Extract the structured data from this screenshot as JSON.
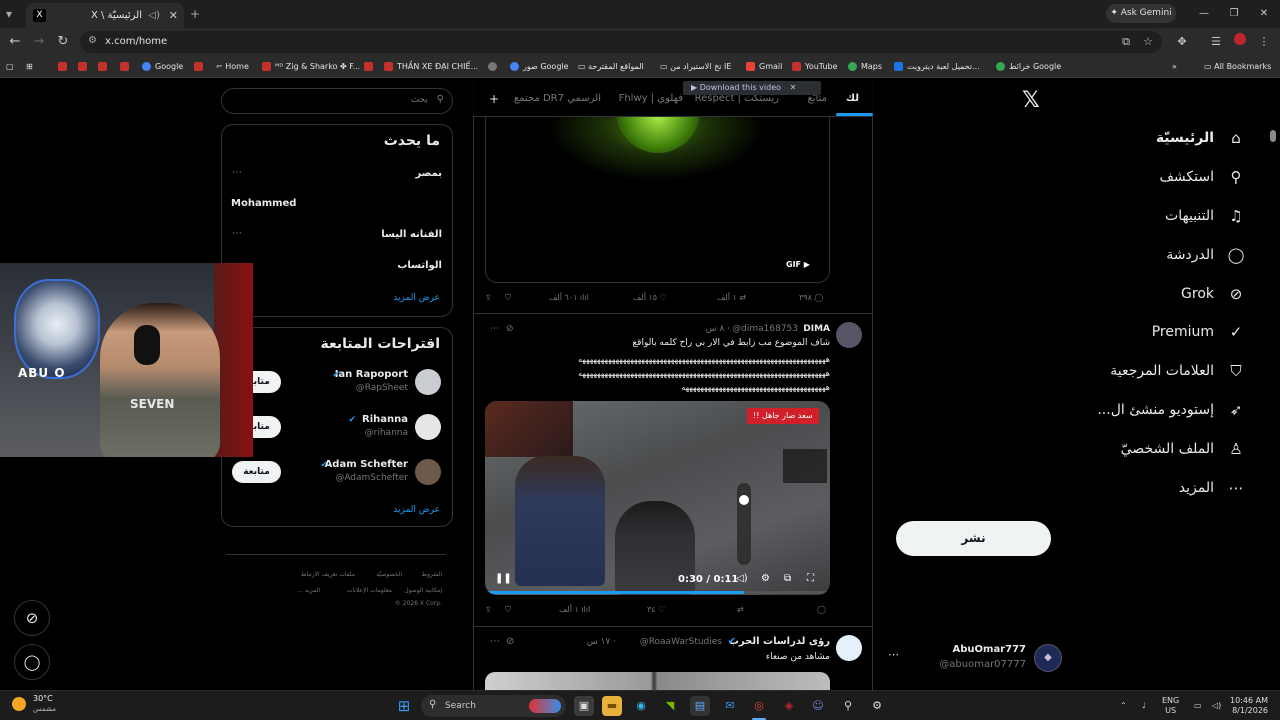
{
  "browser": {
    "tab_title": "الرئيسيّة \\ X",
    "tab_favicon": "X",
    "ask_gemini": "Ask Gemini",
    "url": "x.com/home",
    "bookmarks": [
      "Google",
      "Home",
      "ᴹᴰ Zig & Sharko ✤ F...",
      "THẦN XE ĐẠI CHIẾ...",
      "صور Google",
      "المواقع المقترحة",
      "تخ الاستيراد من IE",
      "Gmail",
      "YouTube",
      "Maps",
      "تحميل لعبة ديترويت...",
      "خرائط Google"
    ],
    "all_bookmarks": "All Bookmarks"
  },
  "nav": {
    "items": [
      {
        "label": "الرئيسيّة",
        "icon": "home-icon",
        "glyph": "⌂"
      },
      {
        "label": "استكشف",
        "icon": "search-icon",
        "glyph": "⚲"
      },
      {
        "label": "التنبيهات",
        "icon": "bell-icon",
        "glyph": "♫"
      },
      {
        "label": "الدردشة",
        "icon": "chat-icon",
        "glyph": "◯"
      },
      {
        "label": "Grok",
        "icon": "grok-icon",
        "glyph": "⊘"
      },
      {
        "label": "Premium",
        "icon": "premium-icon",
        "glyph": "✓"
      },
      {
        "label": "العلامات المرجعية",
        "icon": "bookmark-icon",
        "glyph": "⛉"
      },
      {
        "label": "إستوديو منشئ ال...",
        "icon": "rocket-icon",
        "glyph": "➶"
      },
      {
        "label": "الملف الشخصيّ",
        "icon": "profile-icon",
        "glyph": "♙"
      },
      {
        "label": "المزيد",
        "icon": "more-icon",
        "glyph": "⋯"
      }
    ],
    "post_button": "نشر",
    "account": {
      "name": "AbuOmar777",
      "handle": "@abuomar07777"
    }
  },
  "timeline": {
    "tabs": [
      "لك",
      "متابَع",
      "Respect | ريستكت",
      "Fhlwy | فهلوي",
      "مجتمع DR7 الرسمي"
    ],
    "download_video": "Download this video",
    "gif_label": "GIF",
    "post1_stats": {
      "replies": "٣٩٨",
      "reposts": "١ ألف",
      "likes": "١٥ ألف",
      "views": "٦٠١ ألف"
    },
    "post2": {
      "name": "DIMA",
      "handle": "@dima168753",
      "time": "· ٨ س",
      "lines": [
        "شاف الموضوع مب زابط في الار بي راح كلمه بالواقع",
        "هههههههههههههههههههههههههههههههههههههههههههههههههههههههههههههههههههه",
        "هههههههههههههههههههههههههههههههههههههههههههههههههههههههههههههههههههه",
        "هههههههههههههههههههههههههههههههههههههههه"
      ],
      "video_badge": "سعد صار جاهل !!",
      "video_time": "0:30 / 0:11",
      "video_progress": 0.75,
      "stats": {
        "reposts": "",
        "likes": "٣٤",
        "views": "١ ألف"
      }
    },
    "post3": {
      "name": "رؤى لدراسات الحرب",
      "handle": "@RoaaWarStudies",
      "time": "· ١٧ س",
      "text": "مشاهد من صنعاء"
    }
  },
  "right": {
    "search_placeholder": "بحث",
    "trending_title": "ما يحدث",
    "trends": [
      "بمصر",
      "Mohammed",
      "الفنانه اليسا",
      "الواتساب"
    ],
    "show_more": "عرض المزيد",
    "who_title": "اقتراحات المتابعة",
    "follow_label": "متابعة",
    "who": [
      {
        "name": "Ian Rapoport",
        "handle": "@RapSheet"
      },
      {
        "name": "Rihanna",
        "handle": "@rihanna"
      },
      {
        "name": "Adam Schefter",
        "handle": "@AdamSchefter"
      }
    ],
    "footer": [
      "الشروط",
      "الخصوصيّة",
      "ملفات تعريف الارتباط",
      "إمكانية الوصول",
      "معلومات الإعلانات",
      "المزيد ...",
      "© 2026 X Corp."
    ]
  },
  "webcam": {
    "brand": "ABU O",
    "shirt": "SEVEN"
  },
  "taskbar": {
    "weather_temp": "30°C",
    "weather_desc": "مشمس",
    "search": "Search",
    "lang": "ENG",
    "region": "US",
    "time": "10:46 AM",
    "date": "8/1/2026"
  }
}
